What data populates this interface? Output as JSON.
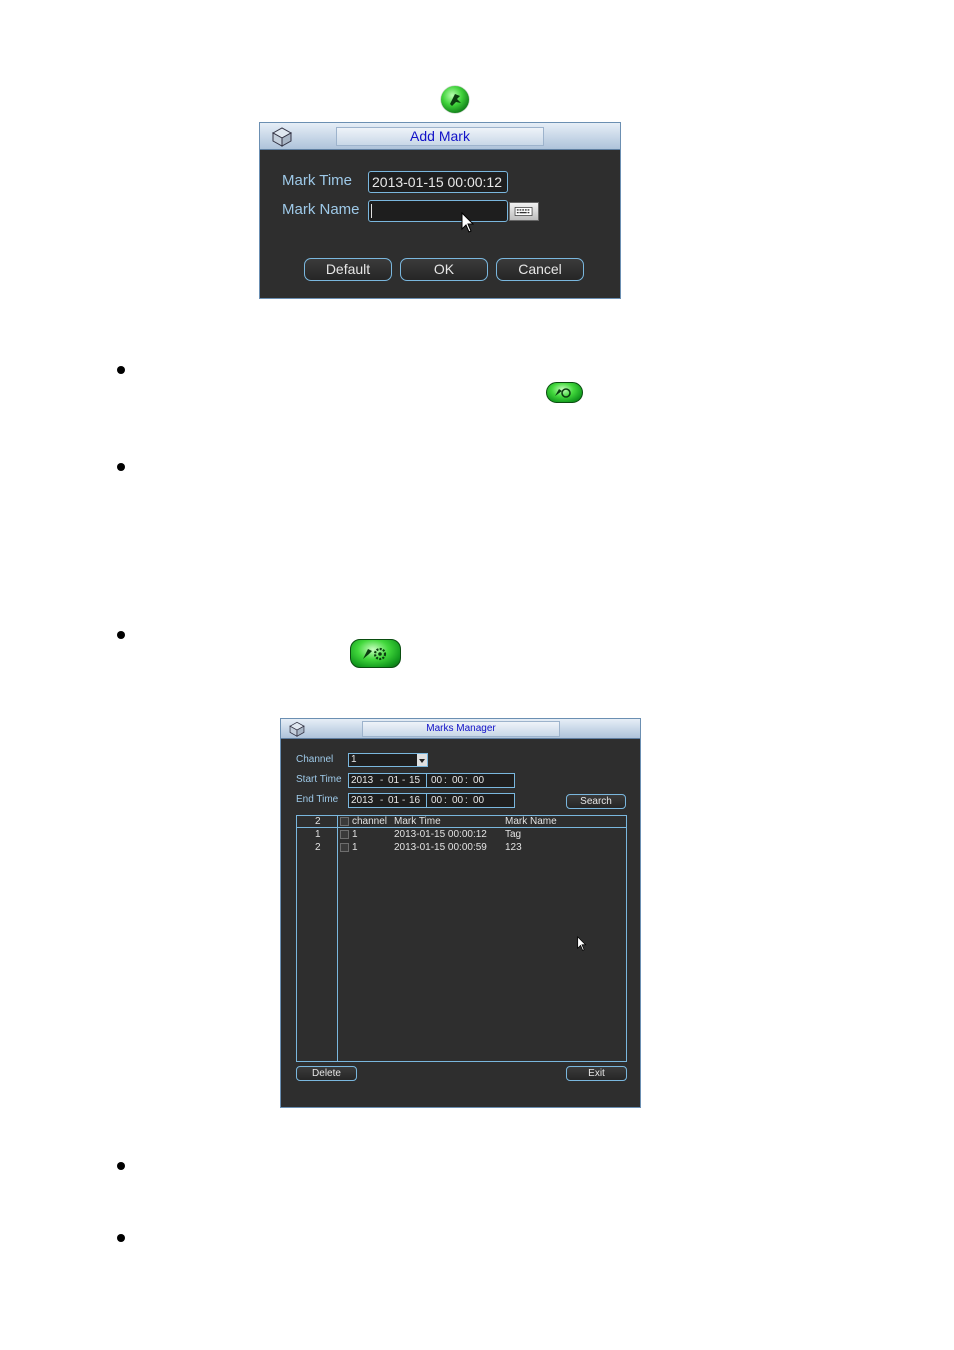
{
  "add_mark": {
    "title": "Add Mark",
    "mark_time_label": "Mark Time",
    "mark_time_value": "2013-01-15 00:00:12",
    "mark_name_label": "Mark Name",
    "mark_name_value": "",
    "buttons": {
      "default": "Default",
      "ok": "OK",
      "cancel": "Cancel"
    }
  },
  "marks_manager": {
    "title": "Marks Manager",
    "channel_label": "Channel",
    "channel_value": "1",
    "start_time_label": "Start Time",
    "start_time": {
      "year": "2013",
      "month": "01",
      "day": "15",
      "hh": "00",
      "mm": "00",
      "ss": "00"
    },
    "end_time_label": "End Time",
    "end_time": {
      "year": "2013",
      "month": "01",
      "day": "16",
      "hh": "00",
      "mm": "00",
      "ss": "00"
    },
    "search_label": "Search",
    "table": {
      "count": "2",
      "columns": {
        "channel": "channel",
        "mark_time": "Mark Time",
        "mark_name": "Mark Name"
      },
      "rows": [
        {
          "index": "1",
          "channel": "1",
          "mark_time": "2013-01-15 00:00:12",
          "mark_name": "Tag"
        },
        {
          "index": "2",
          "channel": "1",
          "mark_time": "2013-01-15 00:00:59",
          "mark_name": "123"
        }
      ]
    },
    "delete_label": "Delete",
    "exit_label": "Exit"
  },
  "icons": {
    "add_mark": "add-mark-icon",
    "play_mark": "play-mark-icon",
    "mark_manager": "mark-manager-icon",
    "keyboard": "keyboard-icon",
    "cursor": "mouse-cursor-icon"
  }
}
